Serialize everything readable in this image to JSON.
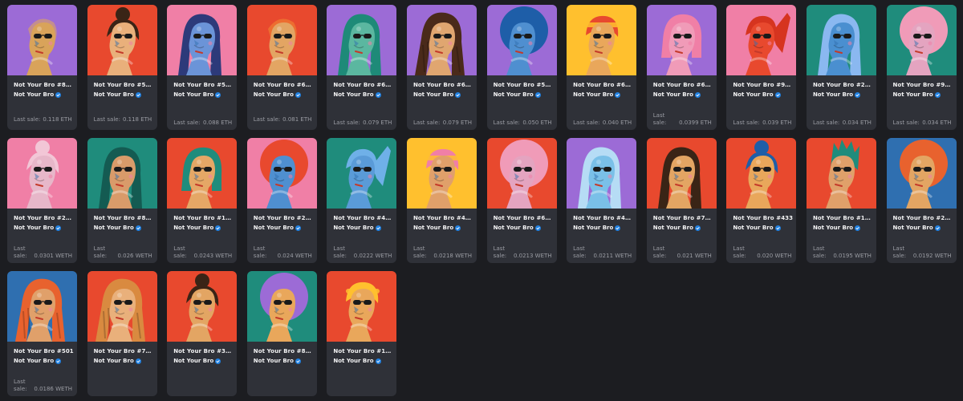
{
  "common": {
    "collection": "Not Your Bro",
    "verified_icon": "verified-badge-icon",
    "verified_color": "#2081e2"
  },
  "items": [
    {
      "name": "Not Your Bro #80...",
      "sale_label": "Last sale:",
      "sale_value": "0.118 ETH",
      "inline": true,
      "bg": "#9c6bd6",
      "skin": "#d9a35a",
      "hair": "#e4ab56",
      "style": "bald"
    },
    {
      "name": "Not Your Bro #55...",
      "sale_label": "Last sale:",
      "sale_value": "0.118 ETH",
      "inline": true,
      "bg": "#e8492e",
      "skin": "#e9b07b",
      "hair": "#3a2416",
      "style": "bun"
    },
    {
      "name": "Not Your Bro #56...",
      "sale_label": "Last sale:",
      "sale_value": "0.088 ETH",
      "inline": false,
      "bg": "#f07fa6",
      "skin": "#6b94d8",
      "hair": "#2d3a7a",
      "style": "long"
    },
    {
      "name": "Not Your Bro #6271",
      "sale_label": "Last sale:",
      "sale_value": "0.081 ETH",
      "inline": true,
      "bg": "#e8492e",
      "skin": "#e3a563",
      "hair": "#f08a33",
      "style": "bald"
    },
    {
      "name": "Not Your Bro #61...",
      "sale_label": "Last sale:",
      "sale_value": "0.079 ETH",
      "inline": false,
      "bg": "#9c6bd6",
      "skin": "#5bb7a0",
      "hair": "#1e8a78",
      "style": "long"
    },
    {
      "name": "Not Your Bro #61...",
      "sale_label": "Last sale:",
      "sale_value": "0.079 ETH",
      "inline": false,
      "bg": "#9c6bd6",
      "skin": "#e0a670",
      "hair": "#4a2a1a",
      "style": "braids"
    },
    {
      "name": "Not Your Bro #58...",
      "sale_label": "Last sale:",
      "sale_value": "0.050 ETH",
      "inline": false,
      "bg": "#9c6bd6",
      "skin": "#4f8fd0",
      "hair": "#1e5ea8",
      "style": "afro"
    },
    {
      "name": "Not Your Bro #65...",
      "sale_label": "Last sale:",
      "sale_value": "0.040 ETH",
      "inline": false,
      "bg": "#ffc02e",
      "skin": "#e9a75b",
      "hair": "#e8492e",
      "style": "short"
    },
    {
      "name": "Not Your Bro #69...",
      "sale_label": "Last sale:",
      "sale_value": "0.0399 ETH",
      "inline": false,
      "bg": "#9c6bd6",
      "skin": "#f09bb8",
      "hair": "#f07fa6",
      "style": "bob"
    },
    {
      "name": "Not Your Bro #97...",
      "sale_label": "Last sale:",
      "sale_value": "0.039 ETH",
      "inline": false,
      "bg": "#f07fa6",
      "skin": "#e8492e",
      "hair": "#d6341f",
      "style": "pony"
    },
    {
      "name": "Not Your Bro #27...",
      "sale_label": "Last sale:",
      "sale_value": "0.034 ETH",
      "inline": false,
      "bg": "#1f8c7c",
      "skin": "#4a8fd0",
      "hair": "#8ab8f0",
      "style": "long"
    },
    {
      "name": "Not Your Bro #93...",
      "sale_label": "Last sale:",
      "sale_value": "0.034 ETH",
      "inline": false,
      "bg": "#1f8c7c",
      "skin": "#e4a4c0",
      "hair": "#f09bb8",
      "style": "afro"
    },
    {
      "name": "Not Your Bro #22...",
      "sale_label": "Last sale:",
      "sale_value": "0.0301 WETH",
      "inline": false,
      "bg": "#f07fa6",
      "skin": "#e7b7c9",
      "hair": "#f2c6d6",
      "style": "bun"
    },
    {
      "name": "Not Your Bro #89...",
      "sale_label": "Last sale:",
      "sale_value": "0.026 WETH",
      "inline": false,
      "bg": "#1f8c7c",
      "skin": "#d99b6a",
      "hair": "#145b52",
      "style": "long"
    },
    {
      "name": "Not Your Bro #1190",
      "sale_label": "Last sale:",
      "sale_value": "0.0243 WETH",
      "inline": false,
      "bg": "#e8492e",
      "skin": "#e5a766",
      "hair": "#1f8c7c",
      "style": "bob"
    },
    {
      "name": "Not Your Bro #2216",
      "sale_label": "Last sale:",
      "sale_value": "0.024 WETH",
      "inline": false,
      "bg": "#f07fa6",
      "skin": "#4f8fd0",
      "hair": "#e8492e",
      "style": "afro"
    },
    {
      "name": "Not Your Bro #40...",
      "sale_label": "Last sale:",
      "sale_value": "0.0222 WETH",
      "inline": false,
      "bg": "#1f8c7c",
      "skin": "#5a9bd8",
      "hair": "#6fb0e8",
      "style": "pony"
    },
    {
      "name": "Not Your Bro #49...",
      "sale_label": "Last sale:",
      "sale_value": "0.0218 WETH",
      "inline": false,
      "bg": "#ffc02e",
      "skin": "#e0a06a",
      "hair": "#f07fa6",
      "style": "short"
    },
    {
      "name": "Not Your Bro #67...",
      "sale_label": "Last sale:",
      "sale_value": "0.0213 WETH",
      "inline": false,
      "bg": "#e8492e",
      "skin": "#e4a4c0",
      "hair": "#f09bb8",
      "style": "afro"
    },
    {
      "name": "Not Your Bro #40...",
      "sale_label": "Last sale:",
      "sale_value": "0.0211 WETH",
      "inline": false,
      "bg": "#9c6bd6",
      "skin": "#7ac0e8",
      "hair": "#b6dcf5",
      "style": "long"
    },
    {
      "name": "Not Your Bro #74...",
      "sale_label": "Last sale:",
      "sale_value": "0.021 WETH",
      "inline": false,
      "bg": "#e8492e",
      "skin": "#e3a563",
      "hair": "#3a2416",
      "style": "long"
    },
    {
      "name": "Not Your Bro #433",
      "sale_label": "Last sale:",
      "sale_value": "0.020 WETH",
      "inline": false,
      "bg": "#e8492e",
      "skin": "#e9a75b",
      "hair": "#1e5ea8",
      "style": "bun"
    },
    {
      "name": "Not Your Bro #19...",
      "sale_label": "Last sale:",
      "sale_value": "0.0195 WETH",
      "inline": false,
      "bg": "#e8492e",
      "skin": "#e0a06a",
      "hair": "#1f8c7c",
      "style": "mohawk"
    },
    {
      "name": "Not Your Bro #24...",
      "sale_label": "Last sale:",
      "sale_value": "0.0192 WETH",
      "inline": false,
      "bg": "#2f6fb0",
      "skin": "#e3a563",
      "hair": "#e8622e",
      "style": "afro"
    },
    {
      "name": "Not Your Bro #501",
      "sale_label": "Last sale:",
      "sale_value": "0.0186 WETH",
      "inline": false,
      "bg": "#2f6fb0",
      "skin": "#e0a06a",
      "hair": "#e8622e",
      "style": "braids"
    },
    {
      "name": "Not Your Bro #77...",
      "sale_label": "",
      "sale_value": "",
      "inline": false,
      "bg": "#e8492e",
      "skin": "#e9b07b",
      "hair": "#d98a40",
      "style": "braids"
    },
    {
      "name": "Not Your Bro #3121",
      "sale_label": "",
      "sale_value": "",
      "inline": false,
      "bg": "#e8492e",
      "skin": "#e3a563",
      "hair": "#3a2416",
      "style": "bun"
    },
    {
      "name": "Not Your Bro #84...",
      "sale_label": "",
      "sale_value": "",
      "inline": false,
      "bg": "#1f8c7c",
      "skin": "#e9a75b",
      "hair": "#9c6bd6",
      "style": "afro"
    },
    {
      "name": "Not Your Bro #18...",
      "sale_label": "",
      "sale_value": "",
      "inline": false,
      "bg": "#e8492e",
      "skin": "#e9a75b",
      "hair": "#ffc02e",
      "style": "short"
    }
  ]
}
